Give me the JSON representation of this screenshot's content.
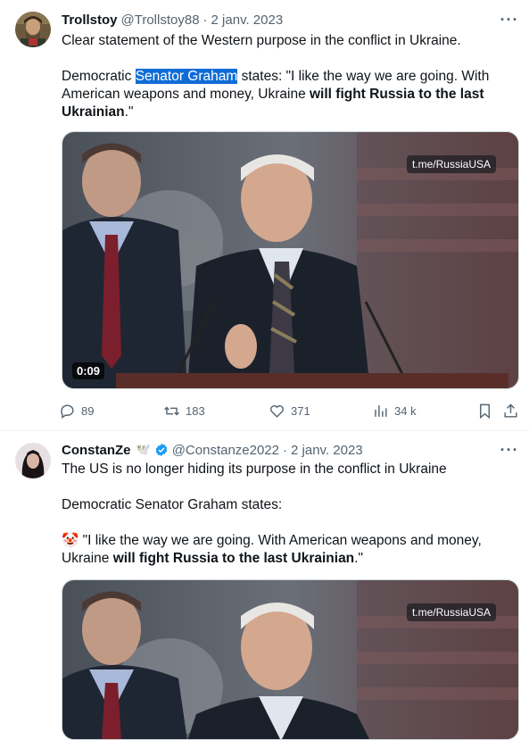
{
  "tweets": [
    {
      "author": {
        "name": "Trollstoy",
        "handle": "@Trollstoy88"
      },
      "date": "2 janv. 2023",
      "more_icon": "more-dots-icon",
      "text": {
        "line1": "Clear statement of the Western purpose in the conflict in Ukraine.",
        "p2_a": "Democratic ",
        "p2_highlight": "Senator Graham",
        "p2_b": " states: \"I like the way we are going. With American weapons and money, Ukraine ",
        "p2_bold": "will fight Russia to the last Ukrainian",
        "p2_c": ".\""
      },
      "media": {
        "watermark": "t.me/RussiaUSA",
        "duration": "0:09"
      },
      "stats": {
        "replies": "89",
        "retweets": "183",
        "likes": "371",
        "views": "34 k"
      }
    },
    {
      "author": {
        "name": "ConstanZe",
        "badge_emoji": "🕊️",
        "verified": true,
        "handle": "@Constanze2022"
      },
      "date": "2 janv. 2023",
      "more_icon": "more-dots-icon",
      "text": {
        "line1": "The US is no longer hiding its purpose in the conflict in Ukraine",
        "line2": "Democratic Senator Graham states:",
        "p3_emoji": "🤡",
        "p3_a": " \"I like the way we are going. With American weapons and money, Ukraine ",
        "p3_bold": "will fight Russia to the last Ukrainian",
        "p3_c": ".\""
      },
      "media": {
        "watermark": "t.me/RussiaUSA"
      }
    }
  ],
  "colors": {
    "text": "#0f1419",
    "secondary": "#536471",
    "verified": "#1d9bf0",
    "highlight": "#0f6cd6"
  }
}
